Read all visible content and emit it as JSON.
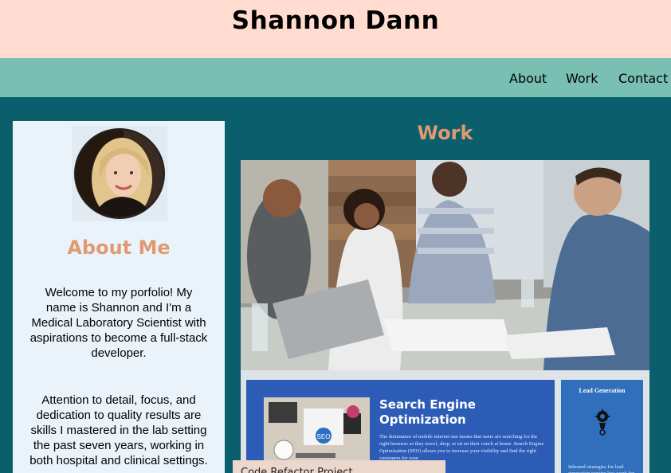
{
  "site": {
    "title": "Shannon Dann"
  },
  "nav": {
    "items": [
      "About",
      "Work",
      "Contact"
    ]
  },
  "about": {
    "heading": "About Me",
    "paragraphs": [
      "Welcome to my porfolio! My name is Shannon and I'm a Medical Laboratory Scientist with aspirations to become a full-stack developer.",
      "Attention to detail, focus, and dedication to quality results are skills I mastered in the lab setting the past seven years, working in both hospital and clinical settings."
    ]
  },
  "work": {
    "heading": "Work",
    "seo_card": {
      "title": "Search Engine Optimization",
      "body": "The dominance of mobile internet use means that users are searching for the right business as they travel, shop, or sit on their couch at home. Search Engine Optimization (SEO) allows you to increase your visibility and find the right customers for your",
      "badge": "SEO"
    },
    "lead_card": {
      "title": "Lead Generation",
      "body": "Inbound strategies for lead generation require less work for your business, bringing"
    },
    "caption": "Code Refactor Project"
  },
  "colors": {
    "header_bg": "#ffdccf",
    "nav_bg": "#79bfb2",
    "page_bg": "#0b5e6b",
    "card_bg": "#ebf3fa",
    "accent": "#e09a72"
  }
}
